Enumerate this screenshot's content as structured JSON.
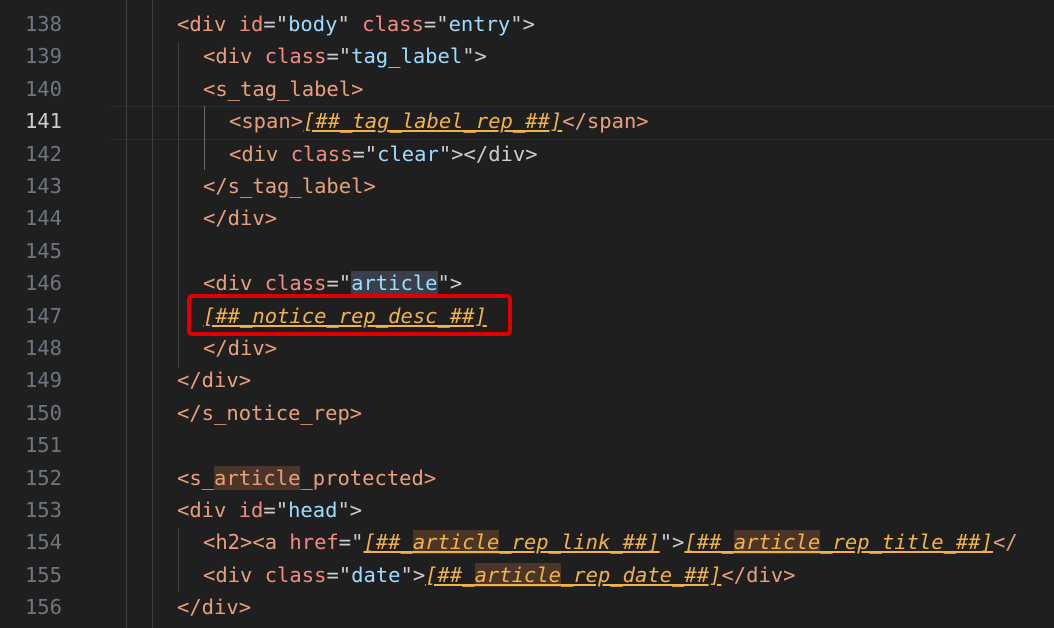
{
  "editor": {
    "line_numbers": [
      "138",
      "139",
      "140",
      "141",
      "142",
      "143",
      "144",
      "145",
      "146",
      "147",
      "148",
      "149",
      "150",
      "151",
      "152",
      "153",
      "154",
      "155",
      "156"
    ],
    "active_line": "141",
    "lines": {
      "l138": {
        "a": "<div ",
        "b": "id",
        "c": "=\"",
        "d": "body",
        "e": "\" ",
        "f": "class",
        "g": "=\"",
        "h": "entry",
        "i": "\">"
      },
      "l139": {
        "a": "<div ",
        "b": "class",
        "c": "=\"",
        "d": "tag_label",
        "e": "\">"
      },
      "l140": {
        "a": "<s_tag_label>"
      },
      "l141": {
        "a": "<span>",
        "b": "[##_tag_label_rep_##]",
        "c": "</span>"
      },
      "l142": {
        "a": "<div ",
        "b": "class",
        "c": "=\"",
        "d": "clear",
        "e": "\"></div>"
      },
      "l143": {
        "a": "</s_tag_label>"
      },
      "l144": {
        "a": "</div>"
      },
      "l146": {
        "a": "<div ",
        "b": "class",
        "c": "=\"",
        "d": "article",
        "e": "\">"
      },
      "l147": {
        "a": "[##_notice_rep_desc_##]"
      },
      "l148": {
        "a": "</div>"
      },
      "l149": {
        "a": "</div>"
      },
      "l150": {
        "a": "</s_notice_rep>"
      },
      "l152": {
        "a": "<s_",
        "b": "article",
        "c": "_protected>"
      },
      "l153": {
        "a": "<div ",
        "b": "id",
        "c": "=\"",
        "d": "head",
        "e": "\">"
      },
      "l154": {
        "a": "<h2><a ",
        "b": "href",
        "c": "=\"",
        "d": "[##_",
        "e": "article",
        "f": "_rep_link_##]",
        "g": "\">",
        "h": "[##_",
        "i": "article",
        "j": "_rep_title_##]",
        "k": "</"
      },
      "l155": {
        "a": "<div ",
        "b": "class",
        "c": "=\"",
        "d": "date",
        "e": "\">",
        "f": "[##_",
        "g": "article",
        "h": "_rep_date_##]",
        "i": "</div>"
      },
      "l156": {
        "a": "</div>"
      }
    }
  }
}
